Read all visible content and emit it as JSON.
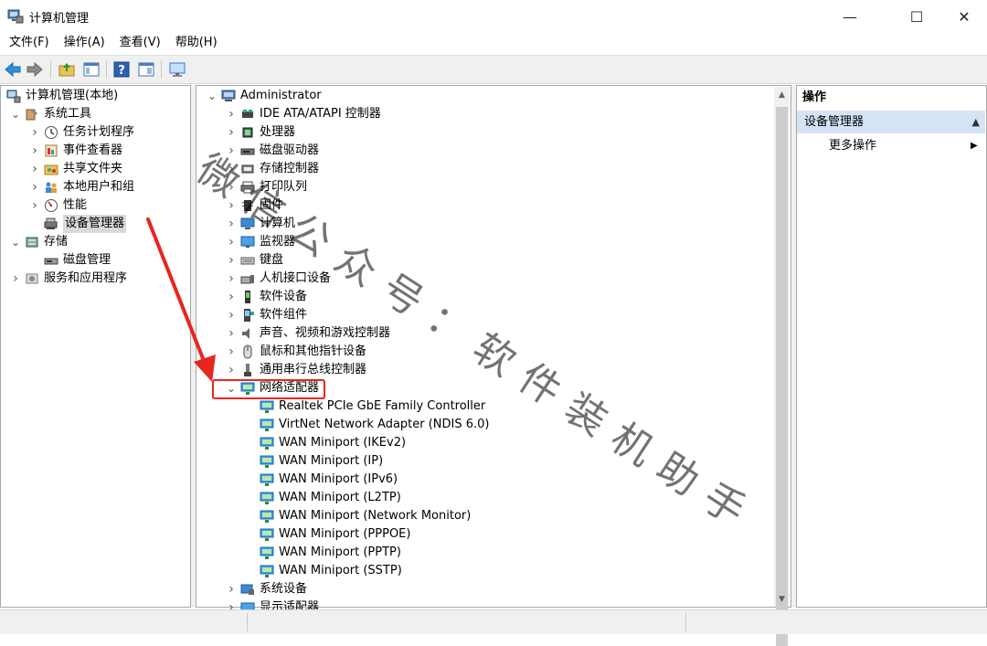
{
  "window": {
    "title": "计算机管理",
    "minimize_glyph": "—",
    "maximize_glyph": "☐",
    "close_glyph": "✕"
  },
  "menu": [
    "文件(F)",
    "操作(A)",
    "查看(V)",
    "帮助(H)"
  ],
  "toolbar": {
    "icons": [
      "back-arrow-icon",
      "forward-arrow-icon",
      "up-folder-icon",
      "show-hide-tree-icon",
      "help-icon",
      "properties-icon",
      "monitor-icon"
    ]
  },
  "left_tree": [
    {
      "label": "计算机管理(本地)",
      "icon": "computer-management-icon"
    },
    {
      "label": "系统工具",
      "icon": "system-tools-icon",
      "expanded": true
    },
    {
      "label": "任务计划程序",
      "icon": "clock-icon"
    },
    {
      "label": "事件查看器",
      "icon": "event-viewer-icon"
    },
    {
      "label": "共享文件夹",
      "icon": "shared-folder-icon"
    },
    {
      "label": "本地用户和组",
      "icon": "users-icon"
    },
    {
      "label": "性能",
      "icon": "performance-icon"
    },
    {
      "label": "设备管理器",
      "icon": "device-manager-icon",
      "selected": true
    },
    {
      "label": "存储",
      "icon": "storage-icon",
      "expanded": true
    },
    {
      "label": "磁盘管理",
      "icon": "disk-icon"
    },
    {
      "label": "服务和应用程序",
      "icon": "services-icon"
    }
  ],
  "device_tree": {
    "root": "Administrator",
    "categories": [
      "IDE ATA/ATAPI 控制器",
      "处理器",
      "磁盘驱动器",
      "存储控制器",
      "打印队列",
      "固件",
      "计算机",
      "监视器",
      "键盘",
      "人机接口设备",
      "软件设备",
      "软件组件",
      "声音、视频和游戏控制器",
      "鼠标和其他指针设备",
      "通用串行总线控制器",
      "网络适配器"
    ],
    "network_adapters": [
      "Realtek PCIe GbE Family Controller",
      "VirtNet Network Adapter (NDIS 6.0)",
      "WAN Miniport (IKEv2)",
      "WAN Miniport (IP)",
      "WAN Miniport (IPv6)",
      "WAN Miniport (L2TP)",
      "WAN Miniport (Network Monitor)",
      "WAN Miniport (PPPOE)",
      "WAN Miniport (PPTP)",
      "WAN Miniport (SSTP)"
    ],
    "after": [
      "系统设备",
      "显示适配器"
    ]
  },
  "actions": {
    "title": "操作",
    "group": "设备管理器",
    "more": "更多操作"
  },
  "watermark": "微信公众号：软件装机助手",
  "colors": {
    "annotation_red": "#e8251f",
    "action_group_bg": "#d5e4f5",
    "selected_bg": "#d9d9d9"
  }
}
